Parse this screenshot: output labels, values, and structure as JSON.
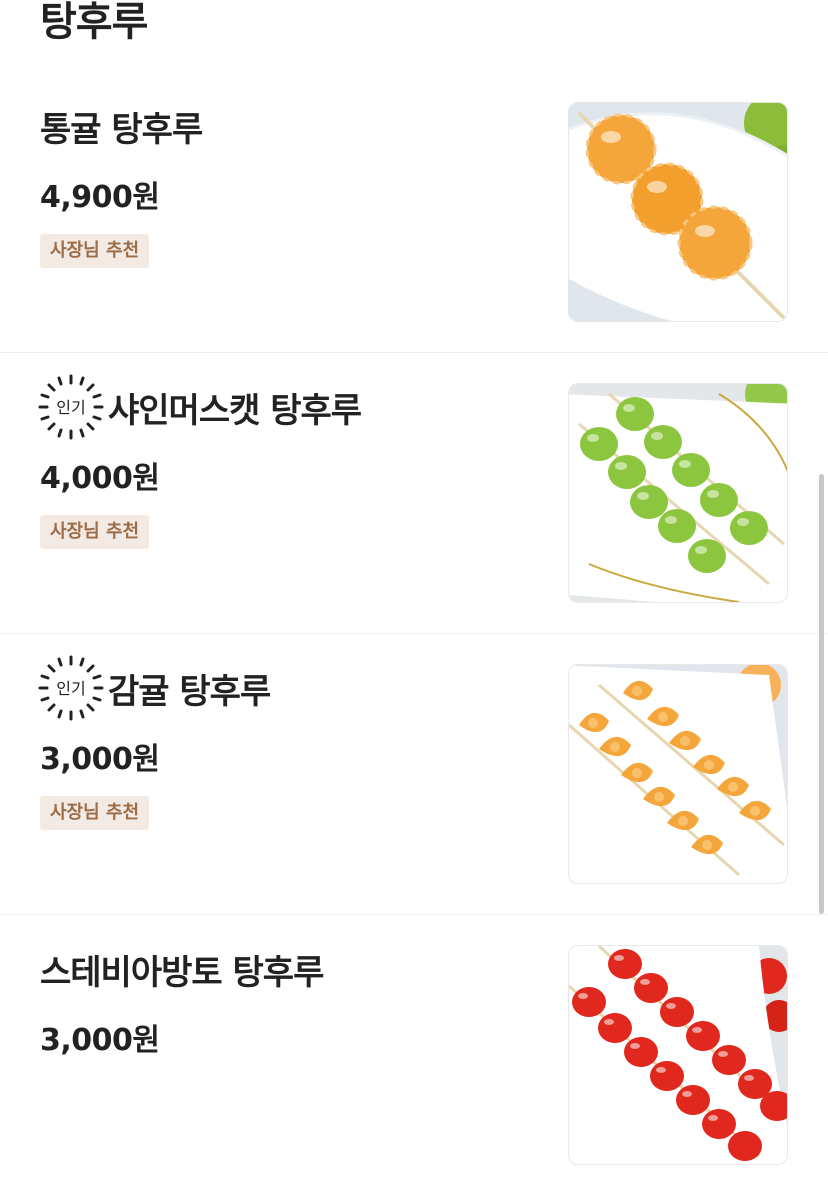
{
  "section": {
    "title": "탕후루"
  },
  "badge": {
    "popular_label": "인기"
  },
  "items": [
    {
      "name": "통귤 탕후루",
      "price": "4,900원",
      "tag": "사장님 추천",
      "popular": false,
      "fruit": "whole-mandarin",
      "image_name": "whole-mandarin-tanghulu-photo"
    },
    {
      "name": "샤인머스캣 탕후루",
      "price": "4,000원",
      "tag": "사장님 추천",
      "popular": true,
      "fruit": "shine-muscat",
      "image_name": "shine-muscat-tanghulu-photo"
    },
    {
      "name": "감귤 탕후루",
      "price": "3,000원",
      "tag": "사장님 추천",
      "popular": true,
      "fruit": "mandarin-segments",
      "image_name": "mandarin-tanghulu-photo"
    },
    {
      "name": "스테비아방토 탕후루",
      "price": "3,000원",
      "tag": "",
      "popular": false,
      "fruit": "cherry-tomato",
      "image_name": "cherry-tomato-tanghulu-photo"
    }
  ],
  "colors": {
    "tag_background": "#f3ebe3",
    "tag_text": "#9c6c48",
    "mandarin": "#f5a63a",
    "grape": "#8cc63f",
    "tomato": "#e0281e",
    "divider": "#eeeeee"
  }
}
